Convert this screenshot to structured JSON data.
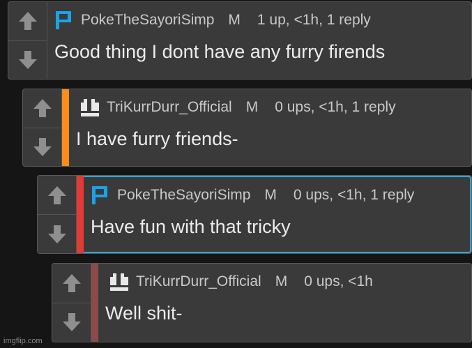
{
  "colors": {
    "background": "#151515",
    "card": "#3a3a3a",
    "accent_orange": "#ff8c1a",
    "accent_red": "#e53935",
    "accent_darkred": "#8e4a4a",
    "highlight_border": "#29a9e0",
    "avatar_blue": "#1aa3e8"
  },
  "icons": {
    "upvote": "arrow-up-icon",
    "downvote": "arrow-down-icon"
  },
  "comments": [
    {
      "username": "PokeTheSayoriSimp",
      "badge": "M",
      "stats": "1 up, <1h, 1 reply",
      "text": "Good thing I dont have any furry firends",
      "avatar": "blue-p-avatar"
    },
    {
      "username": "TriKurrDurr_Official",
      "badge": "M",
      "stats": "0 ups, <1h, 1 reply",
      "text": "I have furry friends-",
      "avatar": "white-blocks-avatar"
    },
    {
      "username": "PokeTheSayoriSimp",
      "badge": "M",
      "stats": "0 ups, <1h, 1 reply",
      "text": "Have fun with that tricky",
      "avatar": "blue-p-avatar"
    },
    {
      "username": "TriKurrDurr_Official",
      "badge": "M",
      "stats": "0 ups, <1h",
      "text": "Well shit-",
      "avatar": "white-blocks-avatar"
    }
  ],
  "watermark": "imgflip.com"
}
